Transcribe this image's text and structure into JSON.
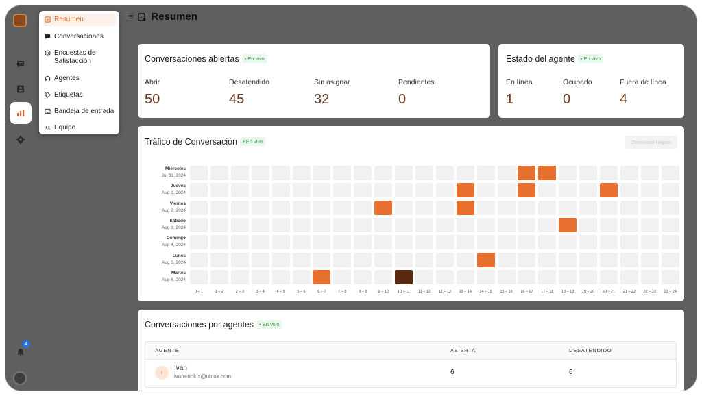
{
  "menu": {
    "items": [
      {
        "label": "Resumen",
        "icon": "report-icon",
        "active": true
      },
      {
        "label": "Conversaciones",
        "icon": "chat-icon"
      },
      {
        "label": "Encuestas de Satisfacción",
        "icon": "smile-icon"
      },
      {
        "label": "Agentes",
        "icon": "headset-icon"
      },
      {
        "label": "Etiquetas",
        "icon": "tag-icon"
      },
      {
        "label": "Bandeja de entrada",
        "icon": "inbox-icon"
      },
      {
        "label": "Equipo",
        "icon": "team-icon"
      }
    ]
  },
  "rail": {
    "notification_count": "4",
    "icons": [
      "chat-icon",
      "contacts-icon",
      "reports-icon",
      "settings-icon"
    ]
  },
  "header": {
    "title": "Resumen"
  },
  "live_label": "• En vivo",
  "open_conversations": {
    "title": "Conversaciones abiertas",
    "metrics": [
      {
        "label": "Abrir",
        "value": "50"
      },
      {
        "label": "Desatendido",
        "value": "45"
      },
      {
        "label": "Sin asignar",
        "value": "32"
      },
      {
        "label": "Pendientes",
        "value": "0"
      }
    ]
  },
  "agent_status": {
    "title": "Estado del agente",
    "metrics": [
      {
        "label": "En línea",
        "value": "1"
      },
      {
        "label": "Ocupado",
        "value": "0"
      },
      {
        "label": "Fuera de línea",
        "value": "4"
      }
    ]
  },
  "traffic": {
    "title": "Tráfico de Conversación",
    "download_label": "Download Report",
    "days": [
      {
        "day": "Miércoles",
        "date": "Jul 31, 2024"
      },
      {
        "day": "Jueves",
        "date": "Aug 1, 2024"
      },
      {
        "day": "Viernes",
        "date": "Aug 2, 2024"
      },
      {
        "day": "Sábado",
        "date": "Aug 3, 2024"
      },
      {
        "day": "Domingo",
        "date": "Aug 4, 2024"
      },
      {
        "day": "Lunes",
        "date": "Aug 5, 2024"
      },
      {
        "day": "Martes",
        "date": "Aug 6, 2024"
      }
    ],
    "hours": [
      "0 – 1",
      "1 – 2",
      "2 – 3",
      "3 – 4",
      "4 – 5",
      "5 – 6",
      "6 – 7",
      "7 – 8",
      "8 – 9",
      "9 – 10",
      "10 – 11",
      "11 – 12",
      "12 – 13",
      "13 – 14",
      "14 – 15",
      "15 – 16",
      "16 – 17",
      "17 – 18",
      "18 – 19",
      "19 – 20",
      "20 – 21",
      "21 – 22",
      "22 – 23",
      "23 – 24"
    ],
    "active_cells": [
      {
        "day": 0,
        "hour": 16,
        "level": "medium"
      },
      {
        "day": 0,
        "hour": 17,
        "level": "medium"
      },
      {
        "day": 1,
        "hour": 13,
        "level": "medium"
      },
      {
        "day": 1,
        "hour": 16,
        "level": "medium"
      },
      {
        "day": 1,
        "hour": 20,
        "level": "medium"
      },
      {
        "day": 2,
        "hour": 9,
        "level": "medium"
      },
      {
        "day": 2,
        "hour": 13,
        "level": "medium"
      },
      {
        "day": 3,
        "hour": 18,
        "level": "medium"
      },
      {
        "day": 5,
        "hour": 14,
        "level": "medium"
      },
      {
        "day": 6,
        "hour": 6,
        "level": "medium"
      },
      {
        "day": 6,
        "hour": 10,
        "level": "high"
      }
    ],
    "colors": {
      "empty": "#f1f1f1",
      "medium": "#e8712f",
      "high": "#5a2a10"
    }
  },
  "agents_table": {
    "title": "Conversaciones por agentes",
    "columns": [
      "AGENTE",
      "ABIERTA",
      "DESATENDIDO"
    ],
    "rows": [
      {
        "initial": "I",
        "name": "Ivan",
        "email": "ivan+ublux@ublux.com",
        "open": "6",
        "unattended": "6"
      }
    ]
  }
}
